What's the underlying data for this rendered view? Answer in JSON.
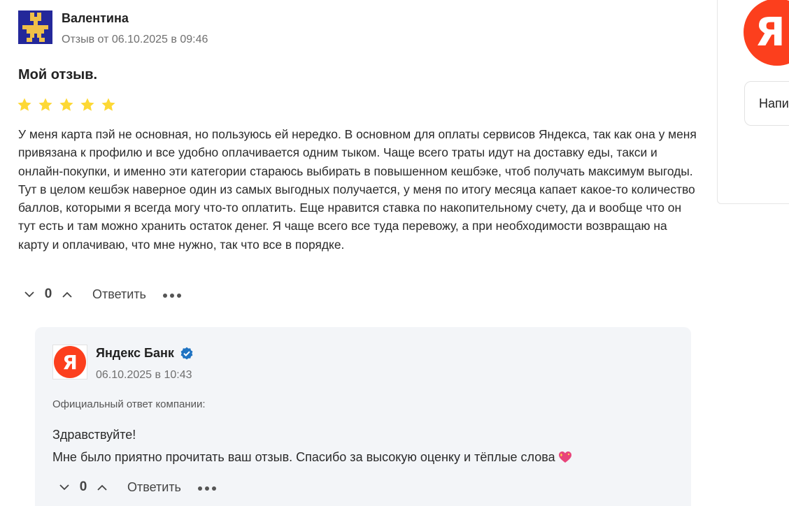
{
  "review": {
    "author": "Валентина",
    "date": "Отзыв от 06.10.2025 в 09:46",
    "title": "Мой отзыв.",
    "rating": 5,
    "rating_color": "#fdd835",
    "text": "У меня карта пэй не основная, но пользуюсь ей нередко. В основном для оплаты сервисов Яндекса, так как она у меня привязана к профилю и все удобно оплачивается одним тыком. Чаще всего траты идут на доставку еды, такси и онлайн-покупки, и именно эти категории стараюсь выбирать в повышенном кешбэке, чтоб получать максимум выгоды. Тут в целом кешбэк наверное один из самых выгодных получается, у меня по итогу месяца капает какое-то количество баллов, которыми я всегда могу что-то оплатить. Еще нравится ставка по накопительному счету, да и вообще что он тут есть и там можно хранить остаток денег. Я чаще всего все туда перевожу, а при необходимости возвращаю на карту и оплачиваю, что мне нужно, так что все в порядке.",
    "votes": "0",
    "reply_label": "Ответить"
  },
  "company_reply": {
    "logo_letter": "Я",
    "name": "Яндекс Банк",
    "date": "06.10.2025 в 10:43",
    "official_label": "Официальный ответ компании:",
    "greeting": "Здравствуйте!",
    "message": "Мне было приятно прочитать ваш отзыв. Спасибо за высокую оценку и тёплые слова",
    "votes": "0",
    "reply_label": "Ответить",
    "brand_color": "#fc3f1d",
    "verified_color": "#1f73c2"
  },
  "side": {
    "logo_letter": "Я",
    "write_label": "Напи"
  }
}
